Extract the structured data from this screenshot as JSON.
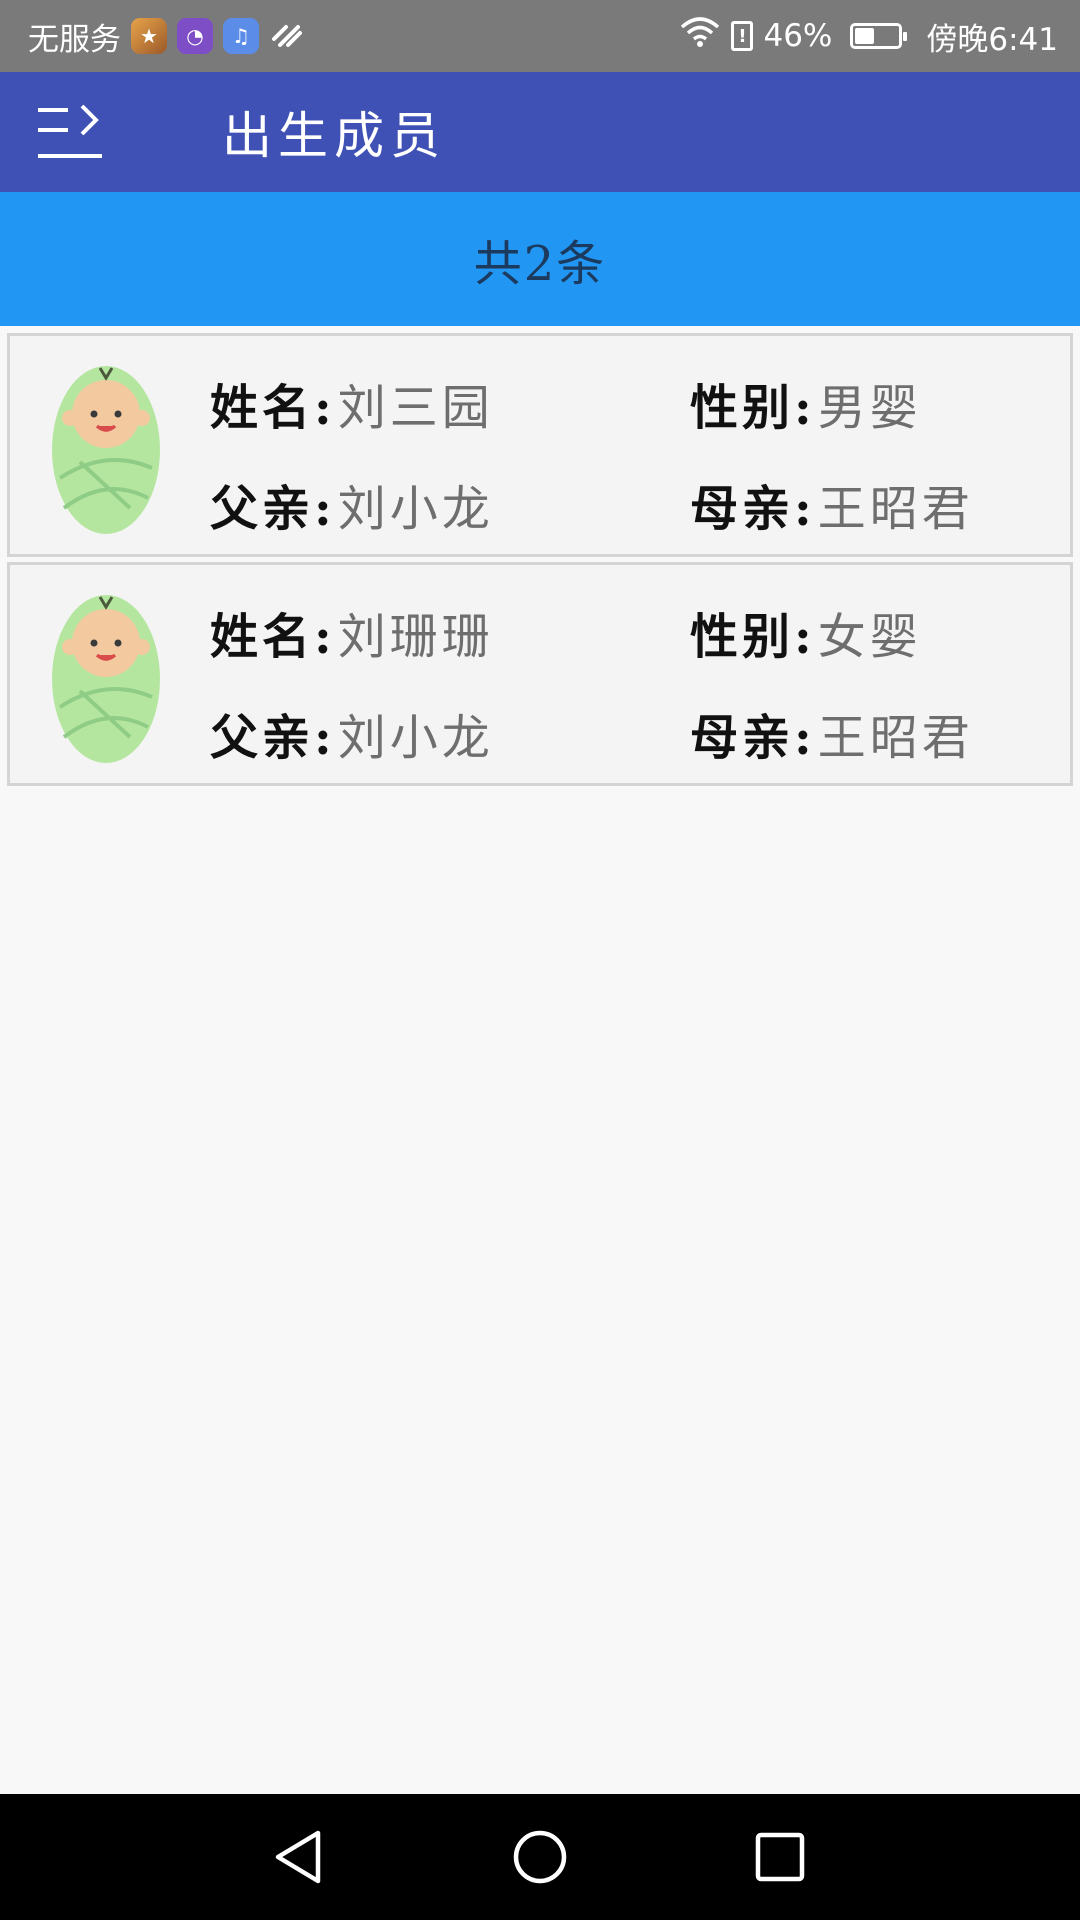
{
  "status_bar": {
    "carrier": "无服务",
    "battery_percent": "46%",
    "time": "傍晚6:41",
    "icons": [
      "game-app-icon",
      "chart-app-icon",
      "music-app-icon",
      "link-app-icon",
      "wifi-icon",
      "alert-icon",
      "battery-icon"
    ]
  },
  "toolbar": {
    "title": "出生成员",
    "menu_icon": "menu-arrow-icon",
    "background": "#3f51b5"
  },
  "banner": {
    "count_text": "共2条",
    "background": "#2196f3"
  },
  "records": [
    {
      "name_label": "姓名",
      "name": "刘三园",
      "gender_label": "性别",
      "gender": "男婴",
      "father_label": "父亲",
      "father": "刘小龙",
      "mother_label": "母亲",
      "mother": "王昭君",
      "avatar_icon": "baby-avatar-icon"
    },
    {
      "name_label": "姓名",
      "name": "刘珊珊",
      "gender_label": "性别",
      "gender": "女婴",
      "father_label": "父亲",
      "father": "刘小龙",
      "mother_label": "母亲",
      "mother": "王昭君",
      "avatar_icon": "baby-avatar-icon"
    }
  ],
  "nav_bar": {
    "icons": [
      "back-triangle-icon",
      "home-circle-icon",
      "recents-square-icon"
    ]
  }
}
